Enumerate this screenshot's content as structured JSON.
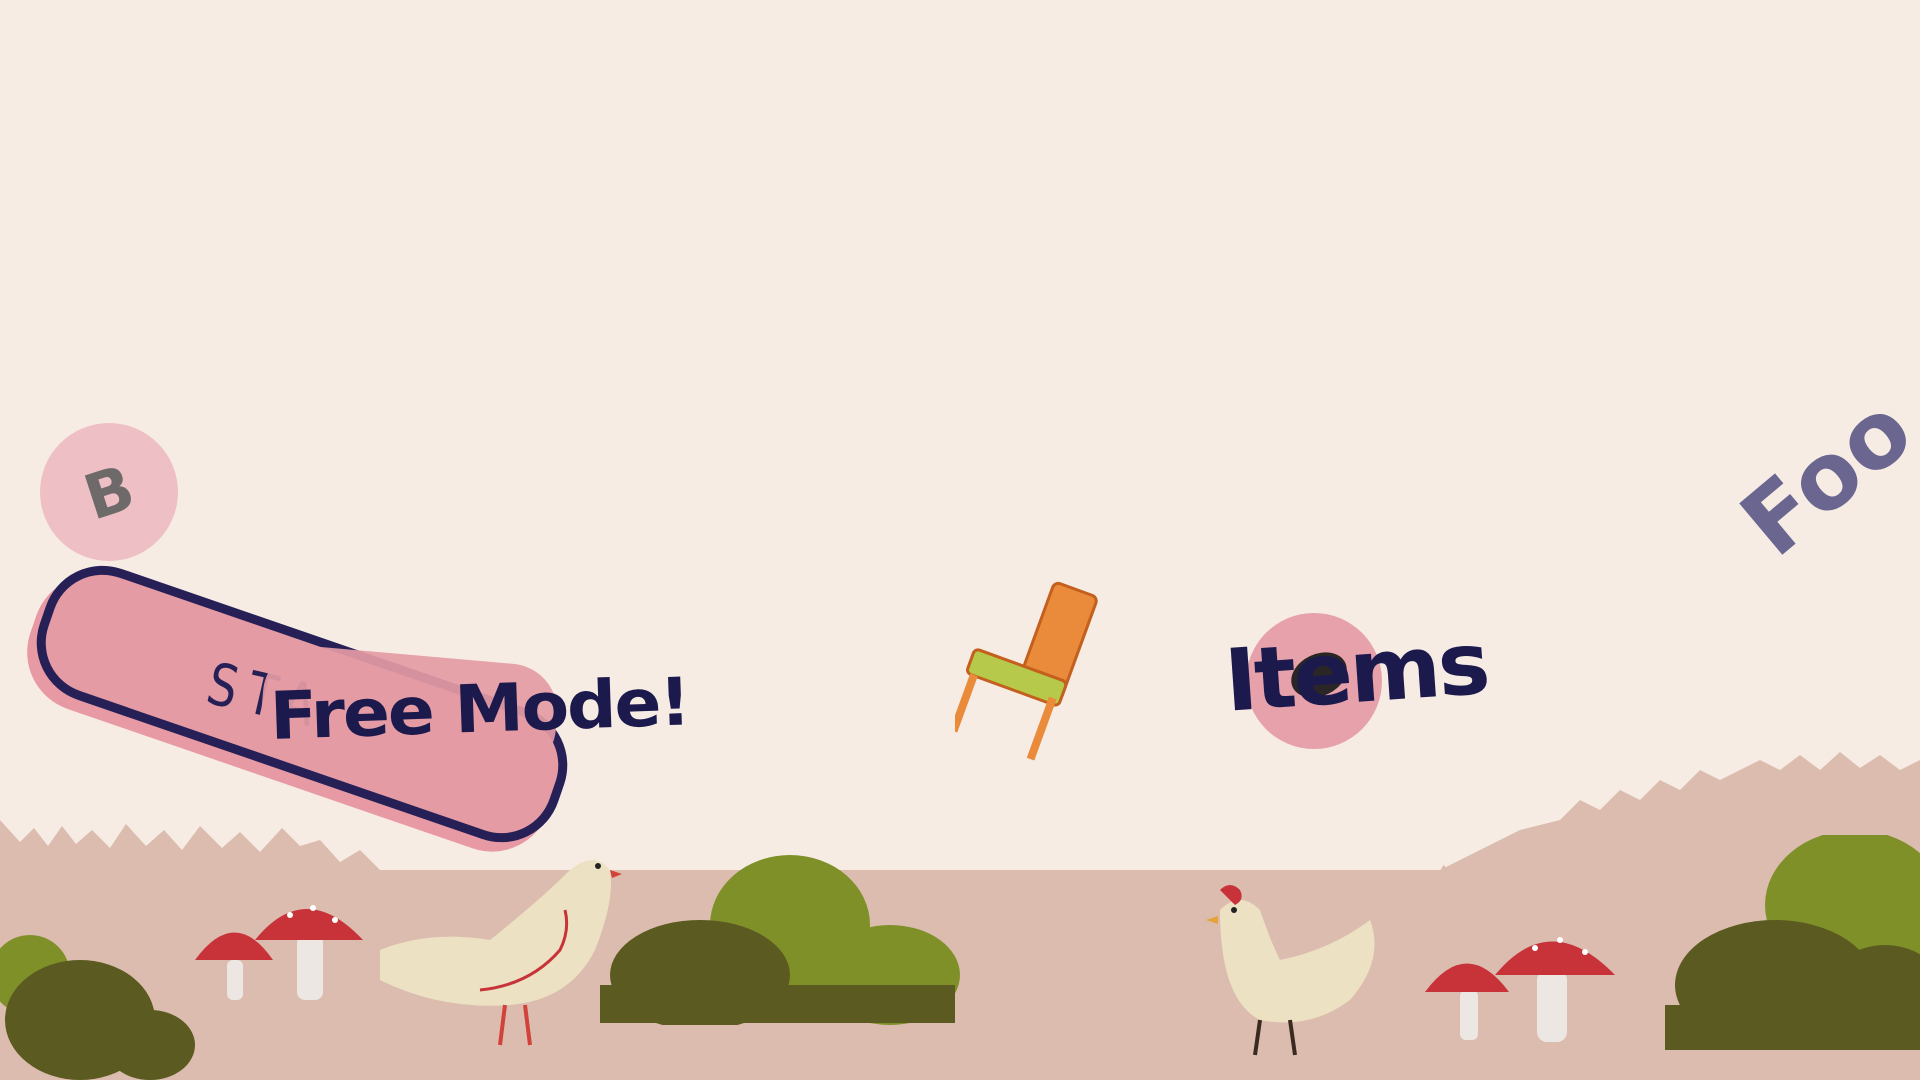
{
  "menu": {
    "badge_letter": "B",
    "start_label": "STA",
    "free_mode_label": "Free Mode!",
    "items_label": "Items",
    "food_label": "Foo"
  },
  "icons": [
    "chair-icon",
    "chicken-icon",
    "dove-icon",
    "mushroom-icon",
    "bush-icon"
  ],
  "colors": {
    "background": "#f6ece4",
    "ground": "#dcbcaf",
    "pink": "#e49ba4",
    "navy": "#1c1a4d",
    "bush_light": "#7f9028",
    "bush_dark": "#5a5a21",
    "mushroom_red": "#c8333a"
  }
}
